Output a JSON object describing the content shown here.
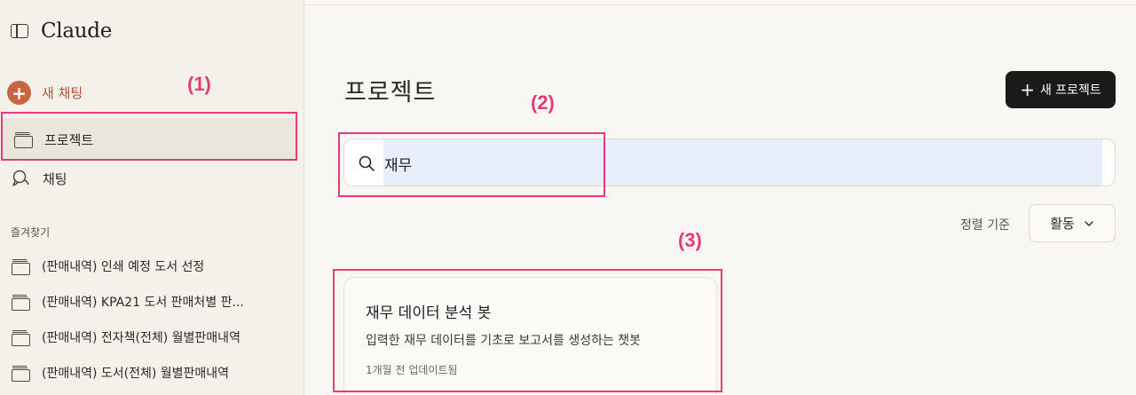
{
  "app": {
    "name": "Claude"
  },
  "sidebar": {
    "new_chat_label": "새 채팅",
    "nav": [
      {
        "label": "프로젝트",
        "icon": "folder-icon"
      },
      {
        "label": "채팅",
        "icon": "chat-icon"
      }
    ],
    "favorites_title": "즐겨찾기",
    "favorites": [
      {
        "label": "(판매내역) 인쇄 예정 도서 선정"
      },
      {
        "label": "(판매내역) KPA21 도서 판매처별 판..."
      },
      {
        "label": "(판매내역) 전자책(전체) 월별판매내역"
      },
      {
        "label": "(판매내역) 도서(전체) 월별판매내역"
      }
    ]
  },
  "main": {
    "title": "프로젝트",
    "new_project_label": "새 프로젝트",
    "search": {
      "value": "재무"
    },
    "sort": {
      "label": "정렬 기준",
      "value": "활동"
    },
    "projects": [
      {
        "title": "재무 데이터 분석 봇",
        "description": "입력한 재무 데이터를 기초로 보고서를 생성하는 챗봇",
        "updated": "1개월 전 업데이트됨"
      }
    ]
  },
  "annotations": {
    "one": "(1)",
    "two": "(2)",
    "three": "(3)"
  },
  "colors": {
    "accent": "#c96442",
    "annotation": "#e8397a",
    "button_dark": "#1b1a18"
  }
}
